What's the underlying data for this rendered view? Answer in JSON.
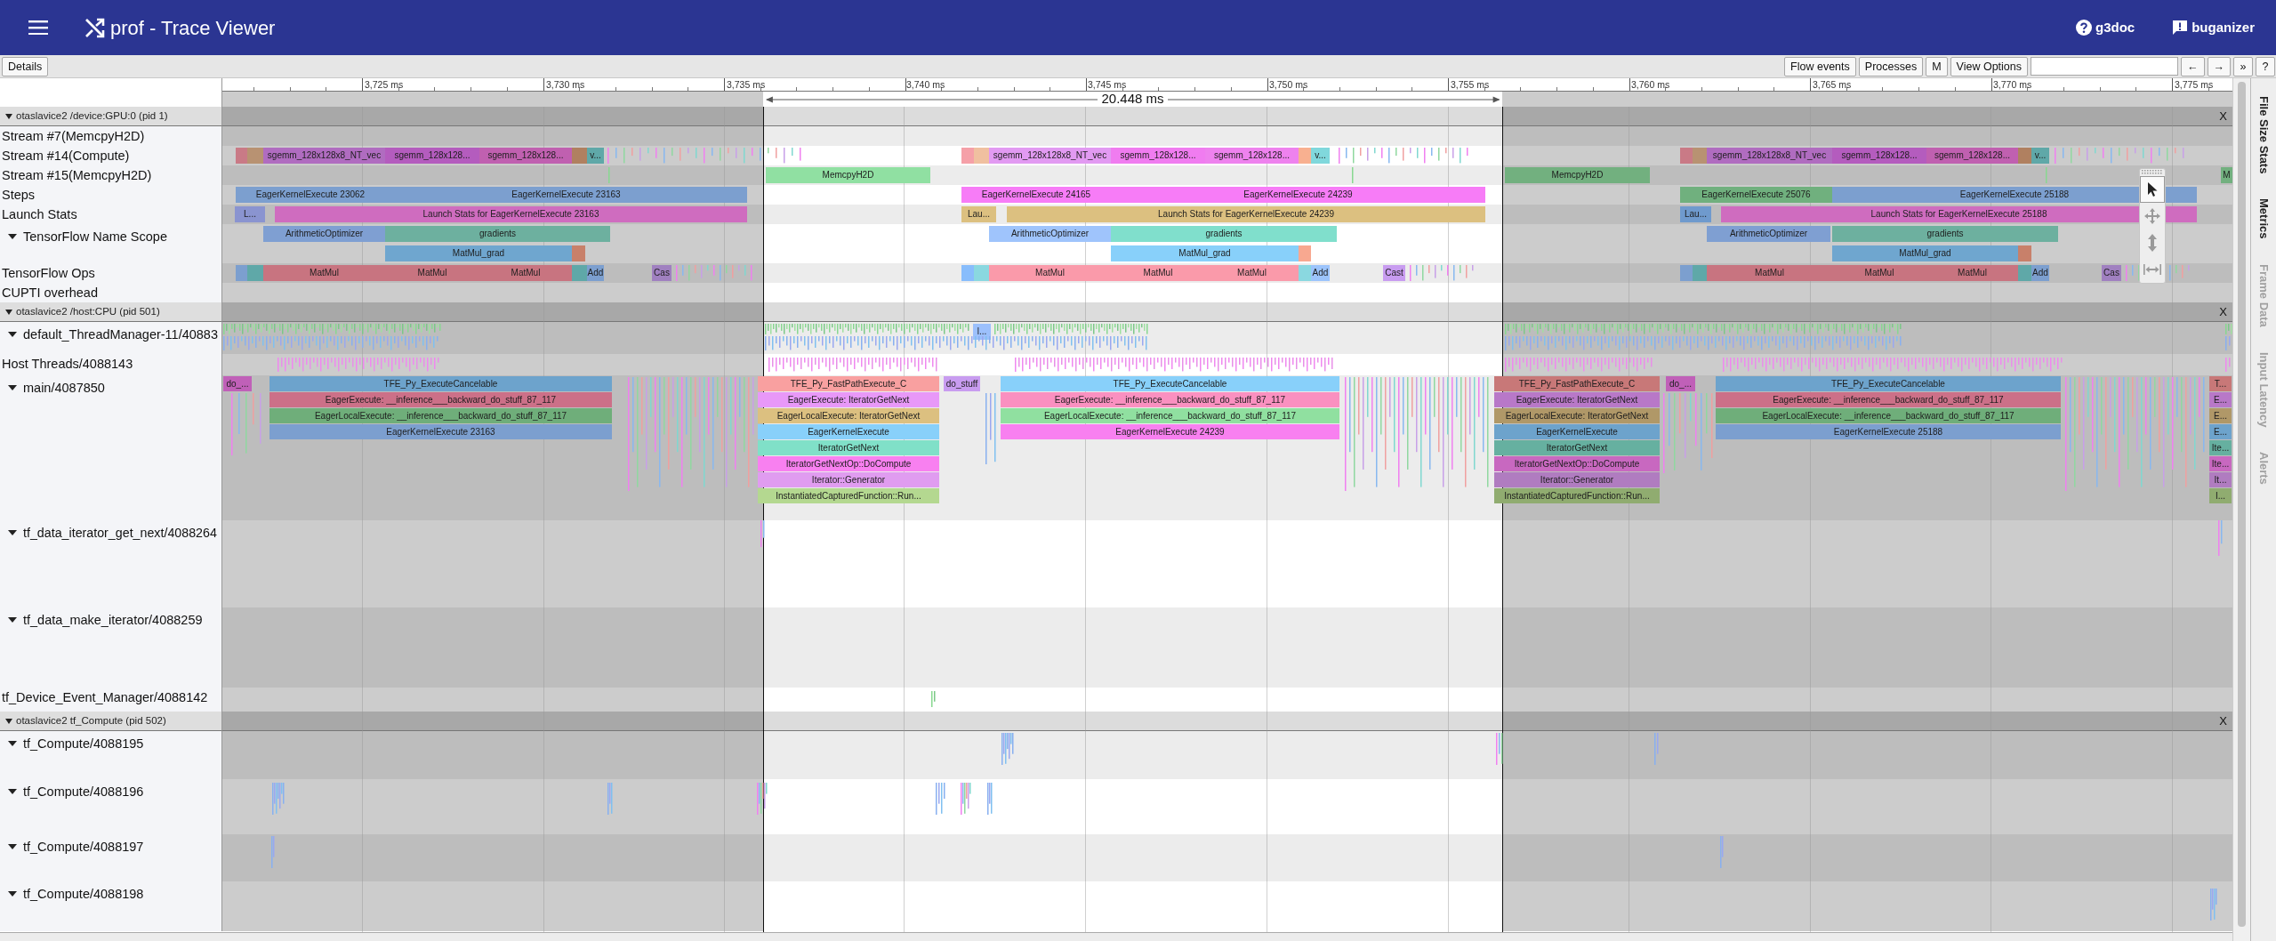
{
  "header": {
    "title": "prof - Trace Viewer",
    "links": [
      {
        "label": "g3doc",
        "kind": "help"
      },
      {
        "label": "buganizer",
        "kind": "feedback"
      }
    ]
  },
  "toolbar": {
    "details": "Details",
    "buttons": [
      "Flow events",
      "Processes",
      "M",
      "View Options"
    ],
    "nav": [
      "←",
      "→",
      "»",
      "?"
    ]
  },
  "ruler": {
    "ticks": [
      "3,725 ms",
      "3,730 ms",
      "3,735 ms",
      "3,740 ms",
      "3,745 ms",
      "3,750 ms",
      "3,755 ms",
      "3,760 ms",
      "3,765 ms",
      "3,770 ms",
      "3,775 ms"
    ],
    "selection": "20.448 ms"
  },
  "tools": [
    {
      "kind": "select",
      "selected": true
    },
    {
      "kind": "pan",
      "selected": false
    },
    {
      "kind": "zoom",
      "selected": false
    },
    {
      "kind": "timing",
      "selected": false
    }
  ],
  "side_tabs": [
    {
      "label": "File Size Stats",
      "disabled": false
    },
    {
      "label": "Metrics",
      "disabled": false
    },
    {
      "label": "Frame Data",
      "disabled": true
    },
    {
      "label": "Input Latency",
      "disabled": true
    },
    {
      "label": "Alerts",
      "disabled": true
    }
  ],
  "processes": [
    {
      "title": "otaslavice2 /device:GPU:0 (pid 1)",
      "expanded": true,
      "close": "X",
      "tracks": [
        {
          "label": "Stream #7(MemcpyH2D)"
        },
        {
          "label": "Stream #14(Compute)",
          "events": [
            {
              "color": "#c97a86"
            },
            {
              "color": "#b89272"
            },
            {
              "label": "sgemm_128x128x8_NT_vec",
              "color": "#b06cc0"
            },
            {
              "label": "sgemm_128x128...",
              "color": "#b45cbe"
            },
            {
              "label": "sgemm_128x128...",
              "color": "#c060b0"
            },
            {
              "color": "#b08060"
            },
            {
              "label": "v...",
              "color": "#5fa8a8"
            },
            {
              "color": "#f5a0a8"
            },
            {
              "color": "#f0c0a0"
            },
            {
              "label": "sgemm_128x128x8_NT_vec",
              "color": "#e29af2"
            },
            {
              "label": "sgemm_128x128...",
              "color": "#f07cf0"
            },
            {
              "label": "sgemm_128x128...",
              "color": "#ee82ee"
            },
            {
              "color": "#f8b090"
            },
            {
              "label": "v...",
              "color": "#80d8dc"
            },
            {
              "color": "#c97a86"
            },
            {
              "color": "#b89272"
            },
            {
              "label": "sgemm_128x128x8_NT_vec",
              "color": "#b06cc0"
            },
            {
              "label": "sgemm_128x128...",
              "color": "#b45cbe"
            },
            {
              "label": "sgemm_128x128...",
              "color": "#c060b0"
            },
            {
              "color": "#b08060"
            },
            {
              "label": "v...",
              "color": "#5fa8a8"
            }
          ]
        },
        {
          "label": "Stream #15(MemcpyH2D)",
          "events": [
            {
              "label": "MemcpyH2D",
              "color": "#90e0a2"
            },
            {
              "label": "MemcpyH2D",
              "color": "#72b07f"
            },
            {
              "label": "M",
              "color": "#72b07f"
            }
          ]
        },
        {
          "label": "Steps",
          "events": [
            {
              "label": "EagerKernelExecute 23062",
              "color": "#7c9fcf"
            },
            {
              "label": "EagerKernelExecute 23163",
              "color": "#7c9fcf"
            },
            {
              "label": "EagerKernelExecute 24165",
              "color": "#f77cf7"
            },
            {
              "label": "EagerKernelExecute 24239",
              "color": "#f77cf7"
            },
            {
              "label": "EagerKernelExecute 25076",
              "color": "#70b07e"
            },
            {
              "label": "EagerKernelExecute 25188",
              "color": "#7c9fcf"
            }
          ]
        },
        {
          "label": "Launch Stats",
          "events": [
            {
              "label": "L...",
              "color": "#8a94d0"
            },
            {
              "label": "Launch Stats for EagerKernelExecute 23163",
              "color": "#cf6cbf"
            },
            {
              "label": "Lau...",
              "color": "#dcc080"
            },
            {
              "label": "Launch Stats for EagerKernelExecute 24239",
              "color": "#dcc080"
            },
            {
              "label": "Lau...",
              "color": "#6f9acd"
            },
            {
              "label": "Launch Stats for EagerKernelExecute 25188",
              "color": "#cf6cbf"
            }
          ]
        },
        {
          "label": "TensorFlow Name Scope",
          "expanded": true,
          "events": [
            {
              "label": "ArithmeticOptimizer",
              "color": "#7f9fd2"
            },
            {
              "label": "gradients",
              "color": "#6db09f"
            },
            {
              "label": "MatMul_grad",
              "color": "#6fa6cf"
            },
            {
              "color": "#c8806a"
            },
            {
              "label": "ArithmeticOptimizer",
              "color": "#9fc4fc"
            },
            {
              "label": "gradients",
              "color": "#80dfcc"
            },
            {
              "label": "MatMul_grad",
              "color": "#88d0fa"
            },
            {
              "color": "#f8a890"
            },
            {
              "label": "ArithmeticOptimizer",
              "color": "#7f9fd2"
            },
            {
              "label": "gradients",
              "color": "#6db09f"
            },
            {
              "label": "MatMul_grad",
              "color": "#6fa6cf"
            },
            {
              "color": "#c8806a"
            }
          ]
        },
        {
          "label": "TensorFlow Ops",
          "events": [
            {
              "color": "#7c9fcf"
            },
            {
              "color": "#5fa8a8"
            },
            {
              "label": "MatMul",
              "color": "#c87480"
            },
            {
              "label": "MatMul",
              "color": "#c87480"
            },
            {
              "label": "MatMul",
              "color": "#c87480"
            },
            {
              "color": "#5fa8a8"
            },
            {
              "label": "Add",
              "color": "#7c9fcf"
            },
            {
              "label": "Cas",
              "color": "#a080c0"
            },
            {
              "color": "#88bdfc"
            },
            {
              "color": "#8ad8e0"
            },
            {
              "label": "MatMul",
              "color": "#fa9aaa"
            },
            {
              "label": "MatMul",
              "color": "#fa9aaa"
            },
            {
              "label": "MatMul",
              "color": "#fa9aaa"
            },
            {
              "color": "#8ad8e0"
            },
            {
              "label": "Add",
              "color": "#9cc4fc"
            },
            {
              "label": "Cast",
              "color": "#c89cf0"
            },
            {
              "color": "#7c9fcf"
            },
            {
              "color": "#5fa8a8"
            },
            {
              "label": "MatMul",
              "color": "#c87480"
            },
            {
              "label": "MatMul",
              "color": "#c87480"
            },
            {
              "label": "MatMul",
              "color": "#c87480"
            },
            {
              "color": "#5fa8a8"
            },
            {
              "label": "Add",
              "color": "#7c9fcf"
            },
            {
              "label": "Cas",
              "color": "#a080c0"
            }
          ]
        },
        {
          "label": "CUPTI overhead"
        }
      ]
    },
    {
      "title": "otaslavice2 /host:CPU (pid 501)",
      "expanded": true,
      "close": "X",
      "tracks": [
        {
          "label": "default_ThreadManager-11/40883",
          "expanded": true,
          "events": [
            {
              "label": "l...",
              "color": "#9cc0fc"
            }
          ]
        },
        {
          "label": "Host Threads/4088143"
        },
        {
          "label": "main/4087850",
          "expanded": true,
          "events": [
            {
              "label": "do_...",
              "color": "#c060b8"
            },
            {
              "label": "TFE_Py_ExecuteCancelable",
              "color": "#6da3cc"
            },
            {
              "label": "EagerExecute: __inference___backward_do_stuff_87_117",
              "color": "#cc7088"
            },
            {
              "label": "EagerLocalExecute: __inference___backward_do_stuff_87_117",
              "color": "#6fae7a"
            },
            {
              "label": "EagerKernelExecute 23163",
              "color": "#7c9fcf"
            },
            {
              "label": "TFE_Py_FastPathExecute_C",
              "color": "#f9a0a0"
            },
            {
              "label": "EagerExecute: IteratorGetNext",
              "color": "#e898f8"
            },
            {
              "label": "EagerLocalExecute: IteratorGetNext",
              "color": "#dcc080"
            },
            {
              "label": "EagerKernelExecute",
              "color": "#88d0fa"
            },
            {
              "label": "IteratorGetNext",
              "color": "#80e0c8"
            },
            {
              "label": "IteratorGetNextOp::DoCompute",
              "color": "#f880f0"
            },
            {
              "label": "Iterator::Generator",
              "color": "#e09cf0"
            },
            {
              "label": "InstantiatedCapturedFunction::Run...",
              "color": "#b4d890"
            },
            {
              "label": "do_stuff",
              "color": "#c89cf0"
            },
            {
              "label": "TFE_Py_ExecuteCancelable",
              "color": "#88d0fa"
            },
            {
              "label": "EagerExecute: __inference___backward_do_stuff_87_117",
              "color": "#fa90c0"
            },
            {
              "label": "EagerLocalExecute: __inference___backward_do_stuff_87_117",
              "color": "#90e0a0"
            },
            {
              "label": "EagerKernelExecute 24239",
              "color": "#f880f0"
            },
            {
              "label": "TFE_Py_FastPathExecute_C",
              "color": "#c87878"
            },
            {
              "label": "EagerExecute: IteratorGetNext",
              "color": "#b878c8"
            },
            {
              "label": "EagerLocalExecute: IteratorGetNext",
              "color": "#b09868"
            },
            {
              "label": "EagerKernelExecute",
              "color": "#6da3cc"
            },
            {
              "label": "IteratorGetNext",
              "color": "#66b0a0"
            },
            {
              "label": "IteratorGetNextOp::DoCompute",
              "color": "#c868c0"
            },
            {
              "label": "Iterator::Generator",
              "color": "#b07cc0"
            },
            {
              "label": "InstantiatedCapturedFunction::Run...",
              "color": "#90ac70"
            },
            {
              "label": "do_...",
              "color": "#c060b8"
            },
            {
              "label": "TFE_Py_ExecuteCancelable",
              "color": "#6da3cc"
            },
            {
              "label": "EagerExecute: __inference___backward_do_stuff_87_117",
              "color": "#cc7088"
            },
            {
              "label": "EagerLocalExecute: __inference___backward_do_stuff_87_117",
              "color": "#6fae7a"
            },
            {
              "label": "EagerKernelExecute 25188",
              "color": "#7c9fcf"
            },
            {
              "label": "T...",
              "color": "#c87878"
            },
            {
              "label": "E...",
              "color": "#b878c8"
            },
            {
              "label": "E...",
              "color": "#b09868"
            },
            {
              "label": "E...",
              "color": "#6da3cc"
            },
            {
              "label": "Ite...",
              "color": "#66b0a0"
            },
            {
              "label": "Ite...",
              "color": "#c868c0"
            },
            {
              "label": "It...",
              "color": "#b07cc0"
            },
            {
              "label": "I...",
              "color": "#90ac70"
            }
          ]
        },
        {
          "label": "tf_data_iterator_get_next/4088264",
          "expanded": true
        },
        {
          "label": "tf_data_make_iterator/4088259",
          "expanded": true
        },
        {
          "label": "tf_Device_Event_Manager/4088142"
        }
      ]
    },
    {
      "title": "otaslavice2 tf_Compute (pid 502)",
      "expanded": true,
      "close": "X",
      "tracks": [
        {
          "label": "tf_Compute/4088195",
          "expanded": true
        },
        {
          "label": "tf_Compute/4088196",
          "expanded": true
        },
        {
          "label": "tf_Compute/4088197",
          "expanded": true
        },
        {
          "label": "tf_Compute/4088198",
          "expanded": true
        }
      ]
    }
  ]
}
